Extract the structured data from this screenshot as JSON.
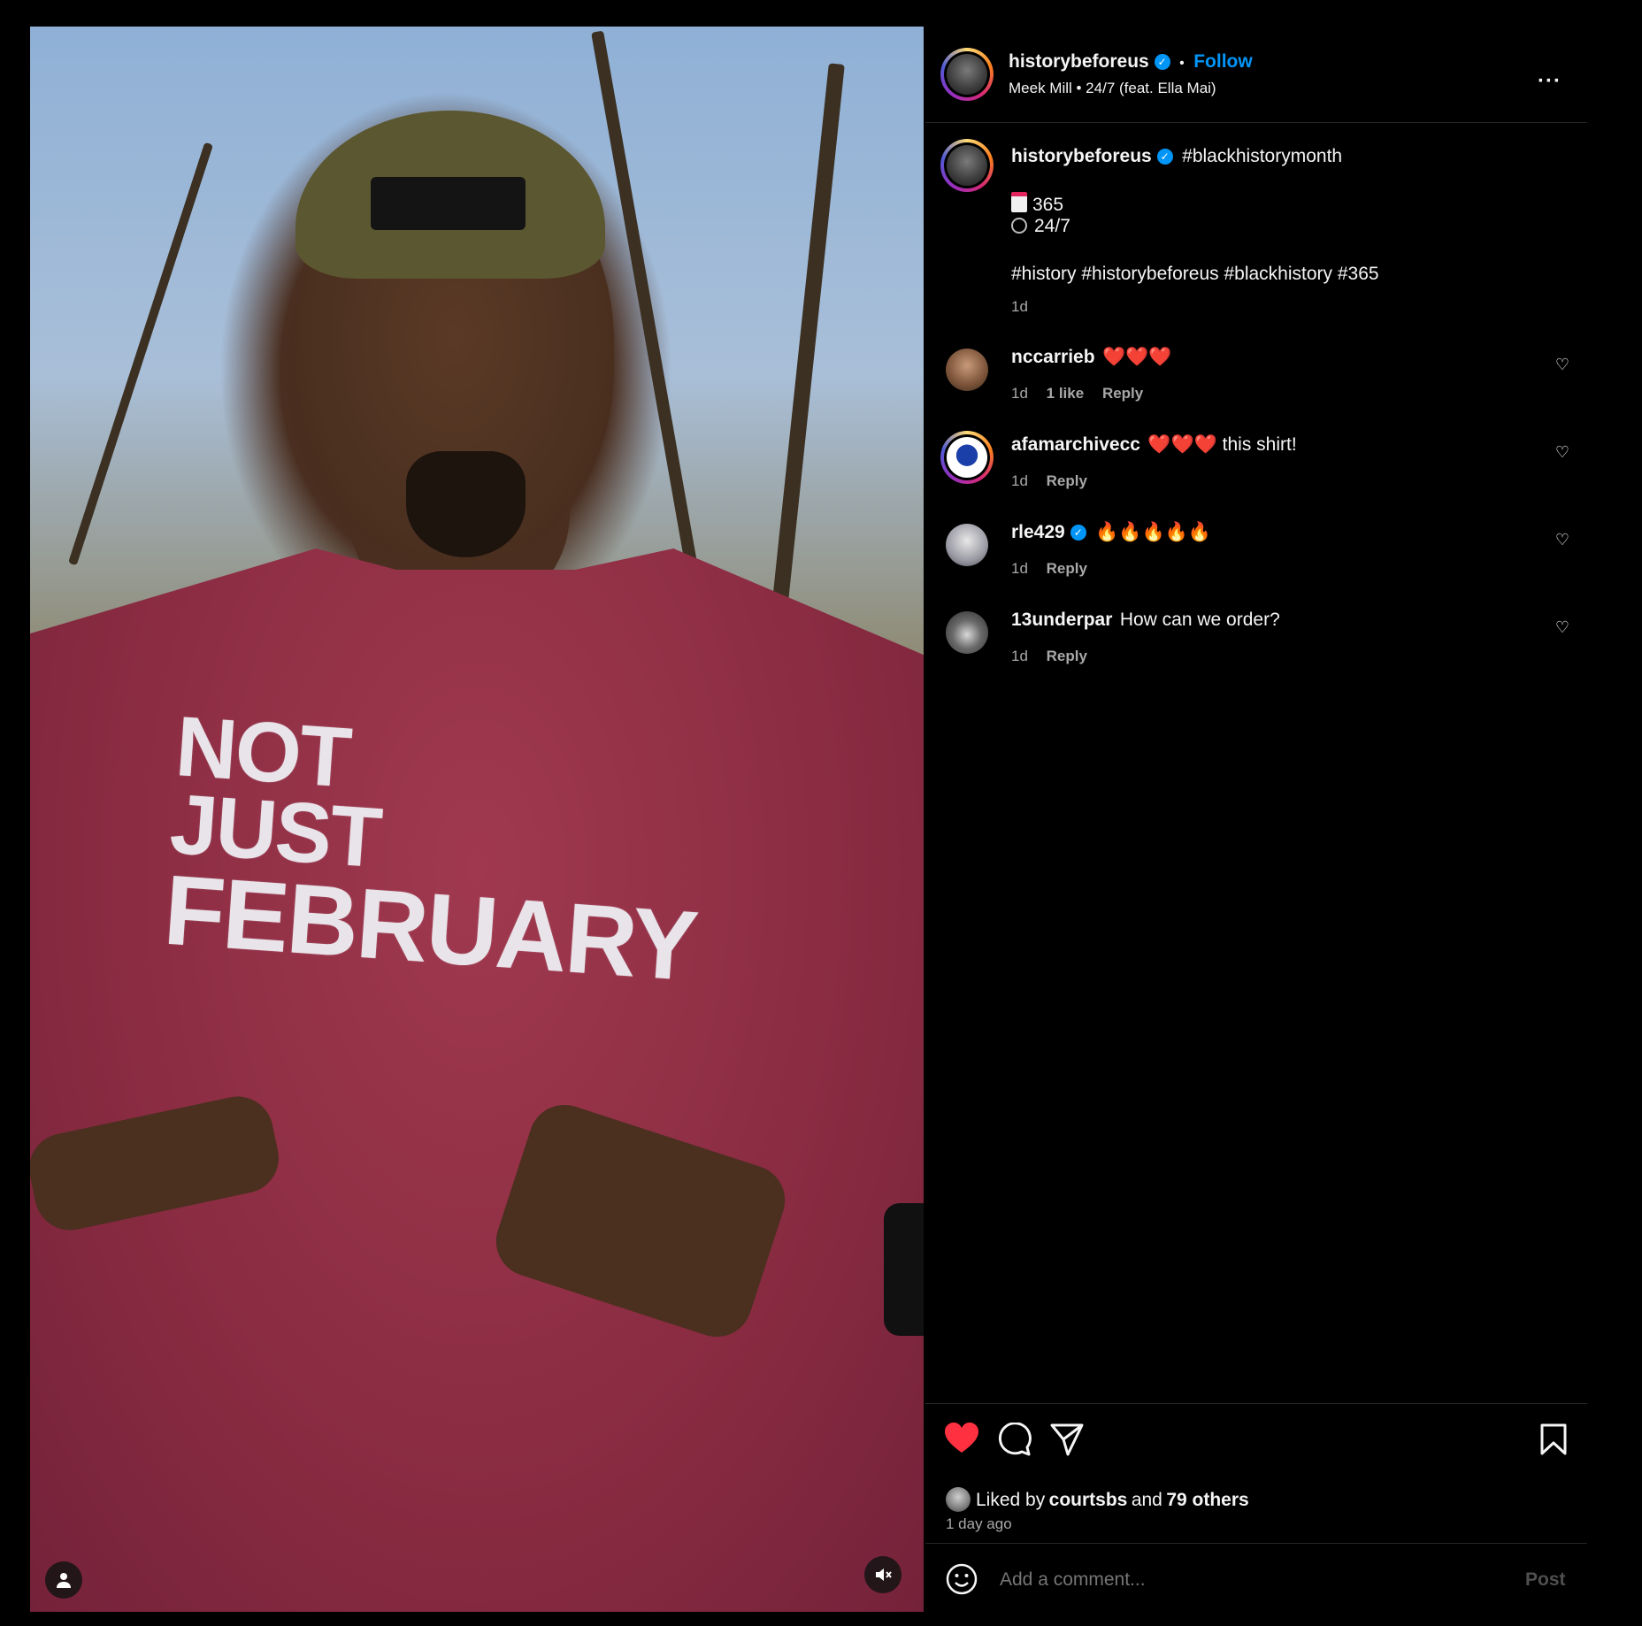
{
  "media": {
    "shirt_lines": [
      "NOT",
      "JUST",
      "FEBRUARY"
    ],
    "profile_icon": "person-icon",
    "mute_icon": "speaker-muted-icon"
  },
  "header": {
    "username": "historybeforeus",
    "separator": "•",
    "follow_label": "Follow",
    "audio": "Meek Mill • 24/7 (feat. Ella Mai)",
    "more_label": "···"
  },
  "caption": {
    "username": "historybeforeus",
    "first_line": "#blackhistorymonth",
    "line_365_icon": "calendar-icon",
    "line_365": "365",
    "line_247_icon": "clock-icon",
    "line_247": "24/7",
    "hashtags": "#history #historybeforeus #blackhistory #365",
    "time": "1d"
  },
  "comments": [
    {
      "username": "nccarrieb",
      "text": "❤️❤️❤️",
      "time": "1d",
      "likes": "1 like",
      "reply": "Reply",
      "verified": false
    },
    {
      "username": "afamarchivecc",
      "text": "❤️❤️❤️ this shirt!",
      "time": "1d",
      "likes": "",
      "reply": "Reply",
      "verified": false
    },
    {
      "username": "rle429",
      "text": "🔥🔥🔥🔥🔥",
      "time": "1d",
      "likes": "",
      "reply": "Reply",
      "verified": true
    },
    {
      "username": "13underpar",
      "text": "How can we order?",
      "time": "1d",
      "likes": "",
      "reply": "Reply",
      "verified": false
    }
  ],
  "actions": {
    "like_icon": "heart-filled-icon",
    "comment_icon": "comment-icon",
    "share_icon": "paper-plane-icon",
    "save_icon": "bookmark-icon",
    "liked_prefix": "Liked by",
    "liked_user": "courtsbs",
    "liked_and": "and",
    "liked_others": "79 others",
    "posted": "1 day ago"
  },
  "composer": {
    "emoji_icon": "smiley-icon",
    "placeholder": "Add a comment...",
    "post_label": "Post"
  },
  "colors": {
    "accent": "#0095f6",
    "like": "#ff3040",
    "muted": "#a8a8a8"
  }
}
